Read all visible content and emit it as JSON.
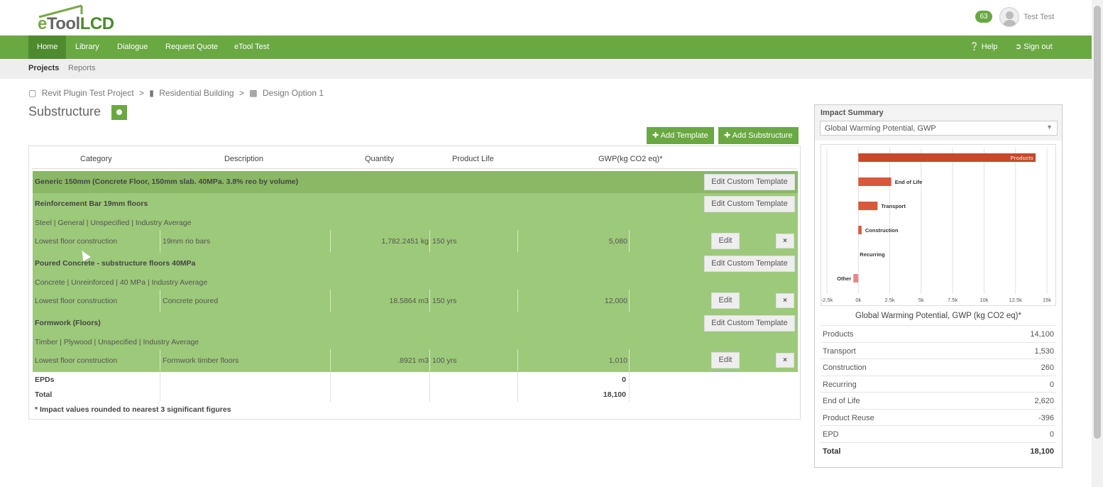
{
  "brand": {
    "logo_e": "e",
    "logo_tool": "Tool",
    "logo_lcd": "LCD"
  },
  "header": {
    "notification_count": "63",
    "user_name": "Test Test"
  },
  "nav": {
    "items": [
      {
        "label": "Home",
        "active": true
      },
      {
        "label": "Library"
      },
      {
        "label": "Dialogue"
      },
      {
        "label": "Request Quote"
      },
      {
        "label": "eTool Test"
      }
    ],
    "help": "Help",
    "signout": "Sign out"
  },
  "subnav": {
    "projects": "Projects",
    "reports": "Reports"
  },
  "breadcrumb": {
    "project": "Revit Plugin Test Project",
    "building": "Residential Building",
    "design": "Design Option 1",
    "sep": ">"
  },
  "page": {
    "title": "Substructure"
  },
  "actions": {
    "add_template": "Add Template",
    "add_substructure": "Add Substructure"
  },
  "table": {
    "headers": [
      "Category",
      "Description",
      "Quantity",
      "Product Life",
      "GWP(kg CO2 eq)*"
    ],
    "template_title": "Generic 150mm (Concrete Floor, 150mm slab. 40MPa. 3.8% reo by volume)",
    "edit_custom_template": "Edit Custom Template",
    "edit": "Edit",
    "remove": "×",
    "items": [
      {
        "name": "Reinforcement Bar 19mm floors",
        "spec": "Steel | General | Unspecified | Industry Average",
        "category": "Lowest floor construction",
        "description": "19mm rio bars",
        "quantity": "1,782.2451 kg",
        "life": "150 yrs",
        "gwp": "5,080"
      },
      {
        "name": "Poured Concrete - substructure floors 40MPa",
        "spec": "Concrete | Unreinforced | 40 MPa | Industry Average",
        "category": "Lowest floor construction",
        "description": "Concrete poured",
        "quantity": "18.5864 m3",
        "life": "150 yrs",
        "gwp": "12,000"
      },
      {
        "name": "Formwork (Floors)",
        "spec": "Timber | Plywood | Unspecified | Industry Average",
        "category": "Lowest floor construction",
        "description": "Formwork timber floors",
        "quantity": ".8921 m3",
        "life": "100 yrs",
        "gwp": "1,010"
      }
    ],
    "epds_label": "EPDs",
    "epds_value": "0",
    "total_label": "Total",
    "total_value": "18,100",
    "footnote": "* Impact values rounded to nearest 3 significant figures"
  },
  "impact": {
    "title": "Impact Summary",
    "selected": "Global Warming Potential, GWP",
    "summary_title": "Global Warming Potential, GWP (kg CO2 eq)*",
    "rows": [
      {
        "k": "Products",
        "v": "14,100"
      },
      {
        "k": "Transport",
        "v": "1,530"
      },
      {
        "k": "Construction",
        "v": "260"
      },
      {
        "k": "Recurring",
        "v": "0"
      },
      {
        "k": "End of Life",
        "v": "2,620"
      },
      {
        "k": "Product Reuse",
        "v": "-396"
      },
      {
        "k": "EPD",
        "v": "0"
      }
    ],
    "total_label": "Total",
    "total_value": "18,100"
  },
  "chart_data": {
    "type": "bar",
    "orientation": "horizontal",
    "categories": [
      "Products",
      "End of Life",
      "Transport",
      "Construction",
      "Recurring",
      "Other"
    ],
    "values": [
      14100,
      2620,
      1530,
      260,
      0,
      -396
    ],
    "tick_labels": [
      "-2.5k",
      "0k",
      "2.5k",
      "5k",
      "7.5k",
      "10k",
      "12.5k",
      "15k"
    ],
    "xlim": [
      -2500,
      15000
    ],
    "grid": true,
    "colors": {
      "bar": "#d9583a",
      "products": "#c9472b",
      "other": "#e58a8a"
    }
  }
}
